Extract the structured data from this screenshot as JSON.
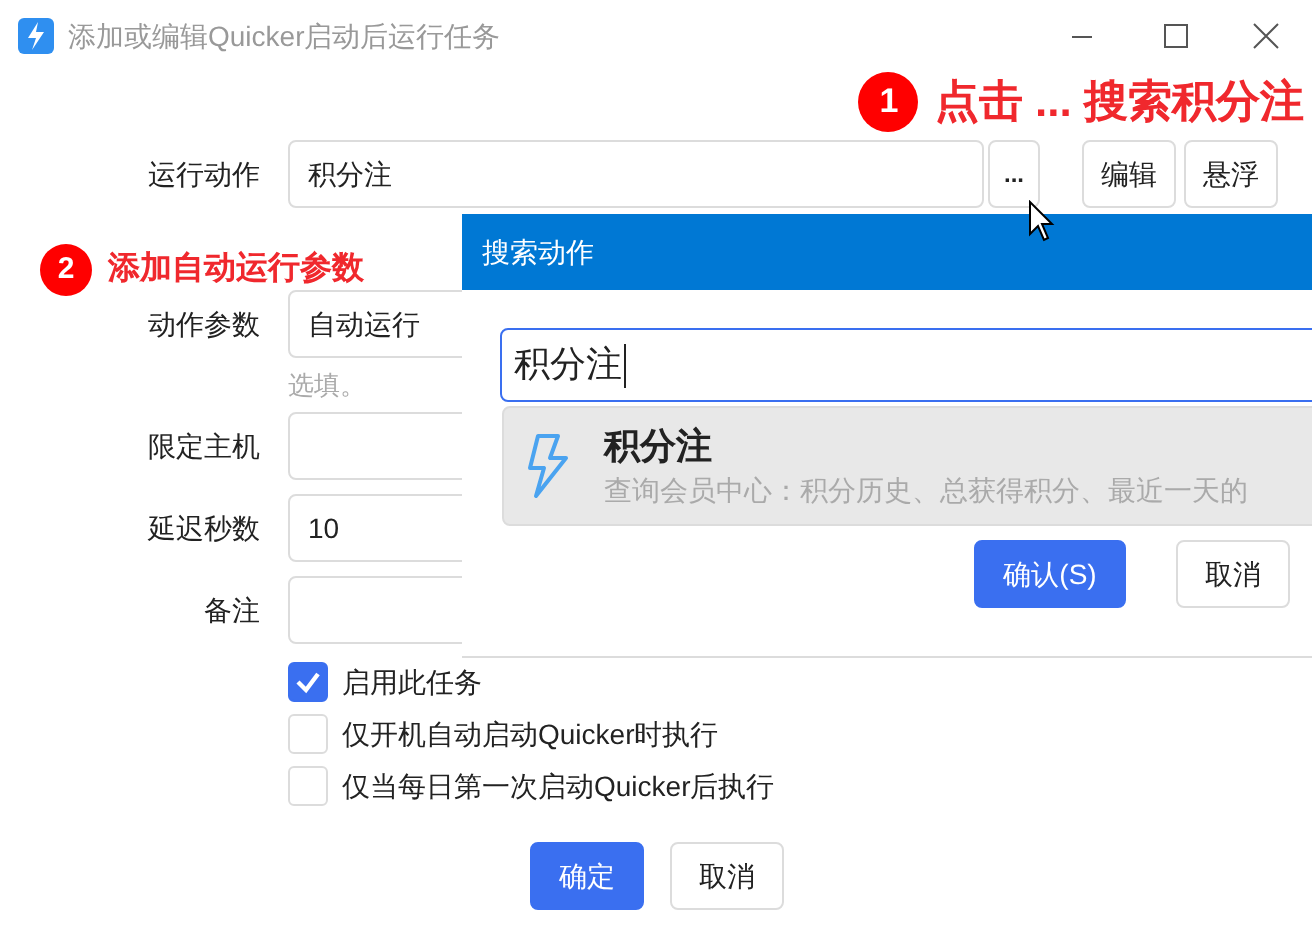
{
  "window": {
    "title": "添加或编辑Quicker启动后运行任务"
  },
  "annotations": [
    {
      "number": "1",
      "text": "点击 ... 搜索积分注"
    },
    {
      "number": "2",
      "text": "添加自动运行参数"
    }
  ],
  "action": {
    "label": "运行动作",
    "value": "积分注",
    "browse_button": "...",
    "buttons": [
      "编辑",
      "悬浮"
    ]
  },
  "fields": [
    {
      "label": "动作参数",
      "value": "自动运行",
      "hint": "选填。"
    },
    {
      "label": "限定主机"
    },
    {
      "label": "延迟秒数",
      "value": "10"
    },
    {
      "label": "备注"
    }
  ],
  "options": [
    {
      "label": "启用此任务",
      "checked": true
    },
    {
      "label": "仅开机自动启动Quicker时执行",
      "checked": false
    },
    {
      "label": "仅当每日第一次启动Quicker后执行",
      "checked": false
    }
  ],
  "buttons": [
    {
      "label": "确定",
      "kind": "primary"
    },
    {
      "label": "取消",
      "kind": "secondary"
    }
  ],
  "search_dialog": {
    "title": "搜索动作",
    "query": "积分注",
    "results": [
      {
        "title": "积分注",
        "description": "查询会员中心：积分历史、总获得积分、最近一天的",
        "selected": true
      }
    ],
    "buttons": [
      {
        "label": "确认(S)",
        "kind": "primary"
      },
      {
        "label": "取消",
        "kind": "secondary"
      }
    ]
  }
}
